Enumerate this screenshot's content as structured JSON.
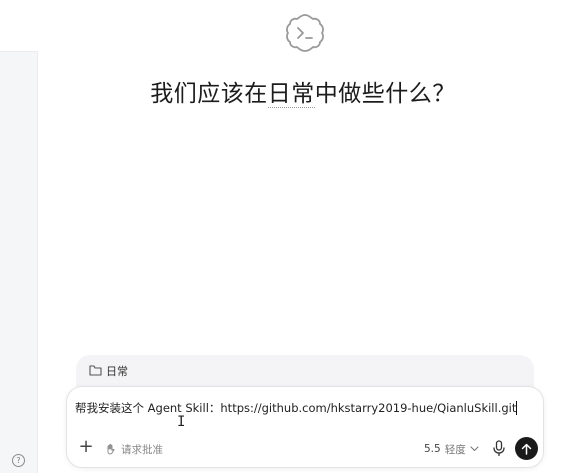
{
  "heading": {
    "prefix": "我们应该在",
    "highlight": "日常",
    "suffix": "中做些什么？"
  },
  "sidebar": {
    "help_glyph": "?"
  },
  "project": {
    "name": "日常",
    "icon": "folder-icon"
  },
  "composer": {
    "text": "帮我安装这个 Agent Skill：https://github.com/hkstarry2019-hue/QianluSkill.git",
    "add_glyph": "+",
    "approval_label": "请求批准",
    "approval_icon": "hand-icon",
    "model_version": "5.5",
    "model_speed": "轻度",
    "mic_icon": "microphone-icon",
    "send_icon": "arrow-up-icon"
  },
  "colors": {
    "send_button": "#1a1a1a",
    "sidebar_bg": "#f5f6f8",
    "project_tab_bg": "#f4f4f6"
  }
}
